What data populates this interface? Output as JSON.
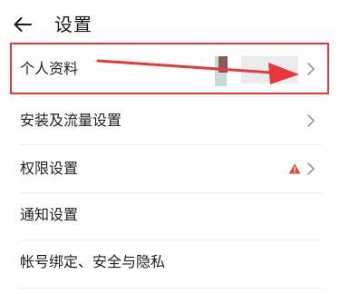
{
  "header": {
    "title": "设置",
    "back_icon": "arrow-left-icon"
  },
  "rows": [
    {
      "label": "个人资料",
      "icon": "chevron-right-icon"
    },
    {
      "label": "安装及流量设置",
      "icon": "chevron-right-icon"
    },
    {
      "label": "权限设置",
      "icon": "chevron-right-icon",
      "badge_icon": "warning-triangle-icon"
    },
    {
      "label": "通知设置"
    },
    {
      "label": "帐号绑定、安全与隐私"
    }
  ],
  "colors": {
    "annotation_red": "#e8383d",
    "warning_red": "#e14a3f"
  }
}
